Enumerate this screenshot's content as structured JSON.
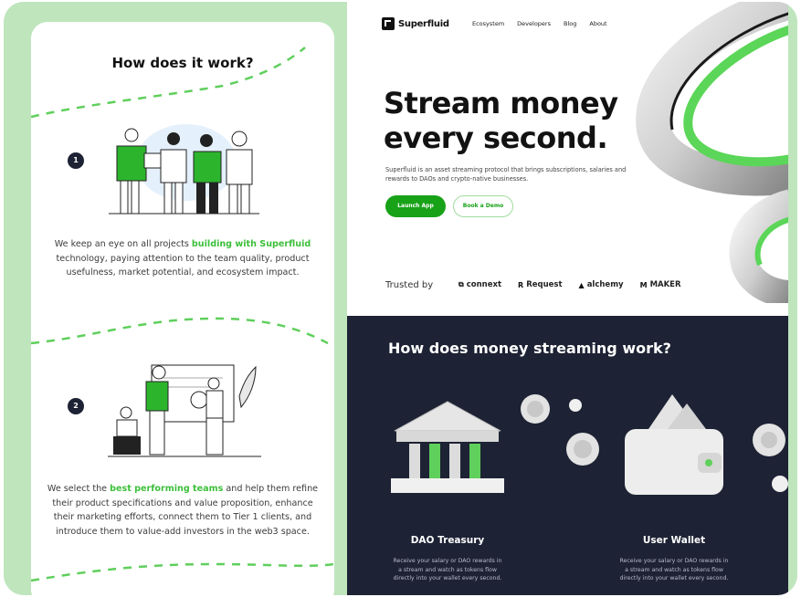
{
  "left": {
    "title": "How does it work?",
    "step1": {
      "number": "1",
      "text_pre": "We keep an eye on all projects ",
      "text_hl": "building with Superfluid",
      "text_post": " technology, paying attention to the team quality, product usefulness, market potential, and ecosystem impact."
    },
    "step2": {
      "number": "2",
      "text_pre": "We select the ",
      "text_hl": "best performing teams",
      "text_post": " and help them refine their product specifications and value proposition, enhance their marketing efforts, connect them to Tier 1 clients, and introduce them to value-add investors in the web3 space."
    }
  },
  "right": {
    "logo": "Superfluid",
    "nav": [
      "Ecosystem",
      "Developers",
      "Blog",
      "About"
    ],
    "hero_title_line1": "Stream money",
    "hero_title_line2": "every second.",
    "hero_sub": "Superfluid is an asset streaming protocol that brings subscriptions, salaries and rewards to DAOs and crypto-native businesses.",
    "btn_launch": "Launch App",
    "btn_demo": "Book a Demo",
    "trusted_label": "Trusted by",
    "partners": [
      {
        "icon": "connext-icon",
        "glyph": "⧉",
        "label": "connext"
      },
      {
        "icon": "request-icon",
        "glyph": "R",
        "label": "Request"
      },
      {
        "icon": "alchemy-icon",
        "glyph": "▲",
        "label": "alchemy"
      },
      {
        "icon": "maker-icon",
        "glyph": "M",
        "label": "MAKER"
      }
    ],
    "dark_title": "How does money streaming work?",
    "cards": [
      {
        "title": "DAO Treasury",
        "desc": "Receive your salary or DAO rewards in a stream and watch as tokens flow directly into your wallet every second."
      },
      {
        "title": "User Wallet",
        "desc": "Receive your salary or DAO rewards in a stream and watch as tokens flow directly into your wallet every second."
      }
    ]
  },
  "colors": {
    "frame_bg": "#bfe5bd",
    "accent_green": "#3cbf3a",
    "button_green": "#18a218",
    "dark_navy": "#1d2234"
  }
}
